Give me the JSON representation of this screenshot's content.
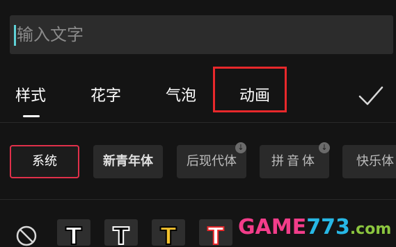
{
  "input": {
    "placeholder": "输入文字"
  },
  "tabs": [
    {
      "label": "样式",
      "active": true
    },
    {
      "label": "花字",
      "active": false
    },
    {
      "label": "气泡",
      "active": false
    },
    {
      "label": "动画",
      "active": false,
      "highlighted": true
    }
  ],
  "confirm": {
    "icon": "checkmark-icon"
  },
  "fonts": [
    {
      "label": "系统",
      "selected": true,
      "downloadable": false
    },
    {
      "label": "新青年体",
      "selected": false,
      "downloadable": false
    },
    {
      "label": "后现代体",
      "selected": false,
      "downloadable": true
    },
    {
      "label": "拼音体",
      "selected": false,
      "downloadable": true
    },
    {
      "label": "快乐体",
      "selected": false,
      "downloadable": false
    }
  ],
  "presets": [
    {
      "icon": "no-style-icon"
    },
    {
      "letter": "T",
      "fill": "#ffffff",
      "stroke": "#000000"
    },
    {
      "letter": "T",
      "fill": "#000000",
      "stroke": "#ffffff"
    },
    {
      "letter": "T",
      "fill": "#f2c12e",
      "stroke": "#000000"
    },
    {
      "letter": "T",
      "fill": "#ffffff",
      "stroke": "#e8282b"
    }
  ],
  "watermark": {
    "part1": "GAME",
    "part2": "773",
    "part3": ".com"
  },
  "colors": {
    "highlight": "#e8282b",
    "caret": "#5fd1d6",
    "selected_chip": "#e0304a"
  }
}
